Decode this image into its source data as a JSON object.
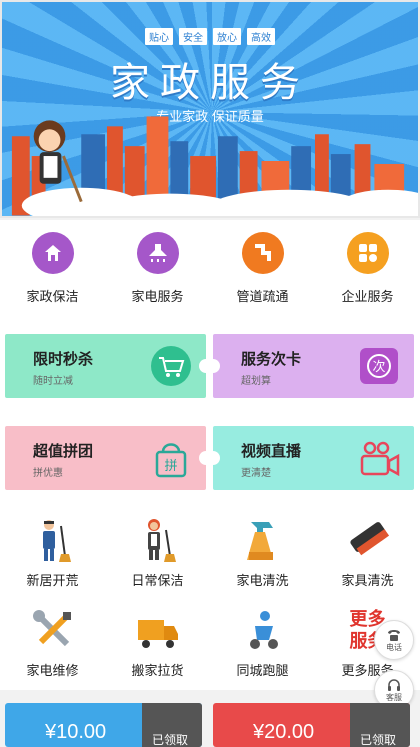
{
  "banner": {
    "tags": [
      "贴心",
      "安全",
      "放心",
      "高效"
    ],
    "title": "家政服务",
    "subtitle": "专业家政  保证质量"
  },
  "categories": [
    {
      "label": "家政保洁",
      "color": "#a557c9",
      "icon": "house-icon"
    },
    {
      "label": "家电服务",
      "color": "#a557c9",
      "icon": "range-hood-icon"
    },
    {
      "label": "管道疏通",
      "color": "#f07a20",
      "icon": "pipe-icon"
    },
    {
      "label": "企业服务",
      "color": "#f5a020",
      "icon": "grid-apps-icon"
    }
  ],
  "cards": [
    {
      "title": "限时秒杀",
      "sub": "随时立减",
      "bg": "#8ee8c8",
      "icon": "cart-icon"
    },
    {
      "title": "服务次卡",
      "sub": "超划算",
      "bg": "#dcb0ef",
      "icon": "ci-card-icon",
      "badge": "次"
    },
    {
      "title": "超值拼团",
      "sub": "拼优惠",
      "bg": "#f8bec8",
      "icon": "group-bag-icon",
      "badge": "拼"
    },
    {
      "title": "视频直播",
      "sub": "更清楚",
      "bg": "#97ece0",
      "icon": "video-camera-icon"
    }
  ],
  "services": [
    {
      "label": "新居开荒",
      "icon": "worker-broom-icon"
    },
    {
      "label": "日常保洁",
      "icon": "cleaner-woman-icon"
    },
    {
      "label": "家电清洗",
      "icon": "spray-bottle-icon"
    },
    {
      "label": "家具清洗",
      "icon": "brush-icon"
    },
    {
      "label": "家电维修",
      "icon": "wrench-screwdriver-icon"
    },
    {
      "label": "搬家拉货",
      "icon": "truck-icon"
    },
    {
      "label": "同城跑腿",
      "icon": "courier-icon"
    },
    {
      "label": "更多服务",
      "icon": "more-services-icon",
      "icon_text": "更多服务"
    }
  ],
  "floating": {
    "phone": "电话",
    "service": "客服"
  },
  "vouchers": [
    {
      "amount": "¥10.00",
      "action": "已领取",
      "color": "#3fa7e8"
    },
    {
      "amount": "¥20.00",
      "action": "已领取",
      "color": "#e84a4a"
    }
  ]
}
